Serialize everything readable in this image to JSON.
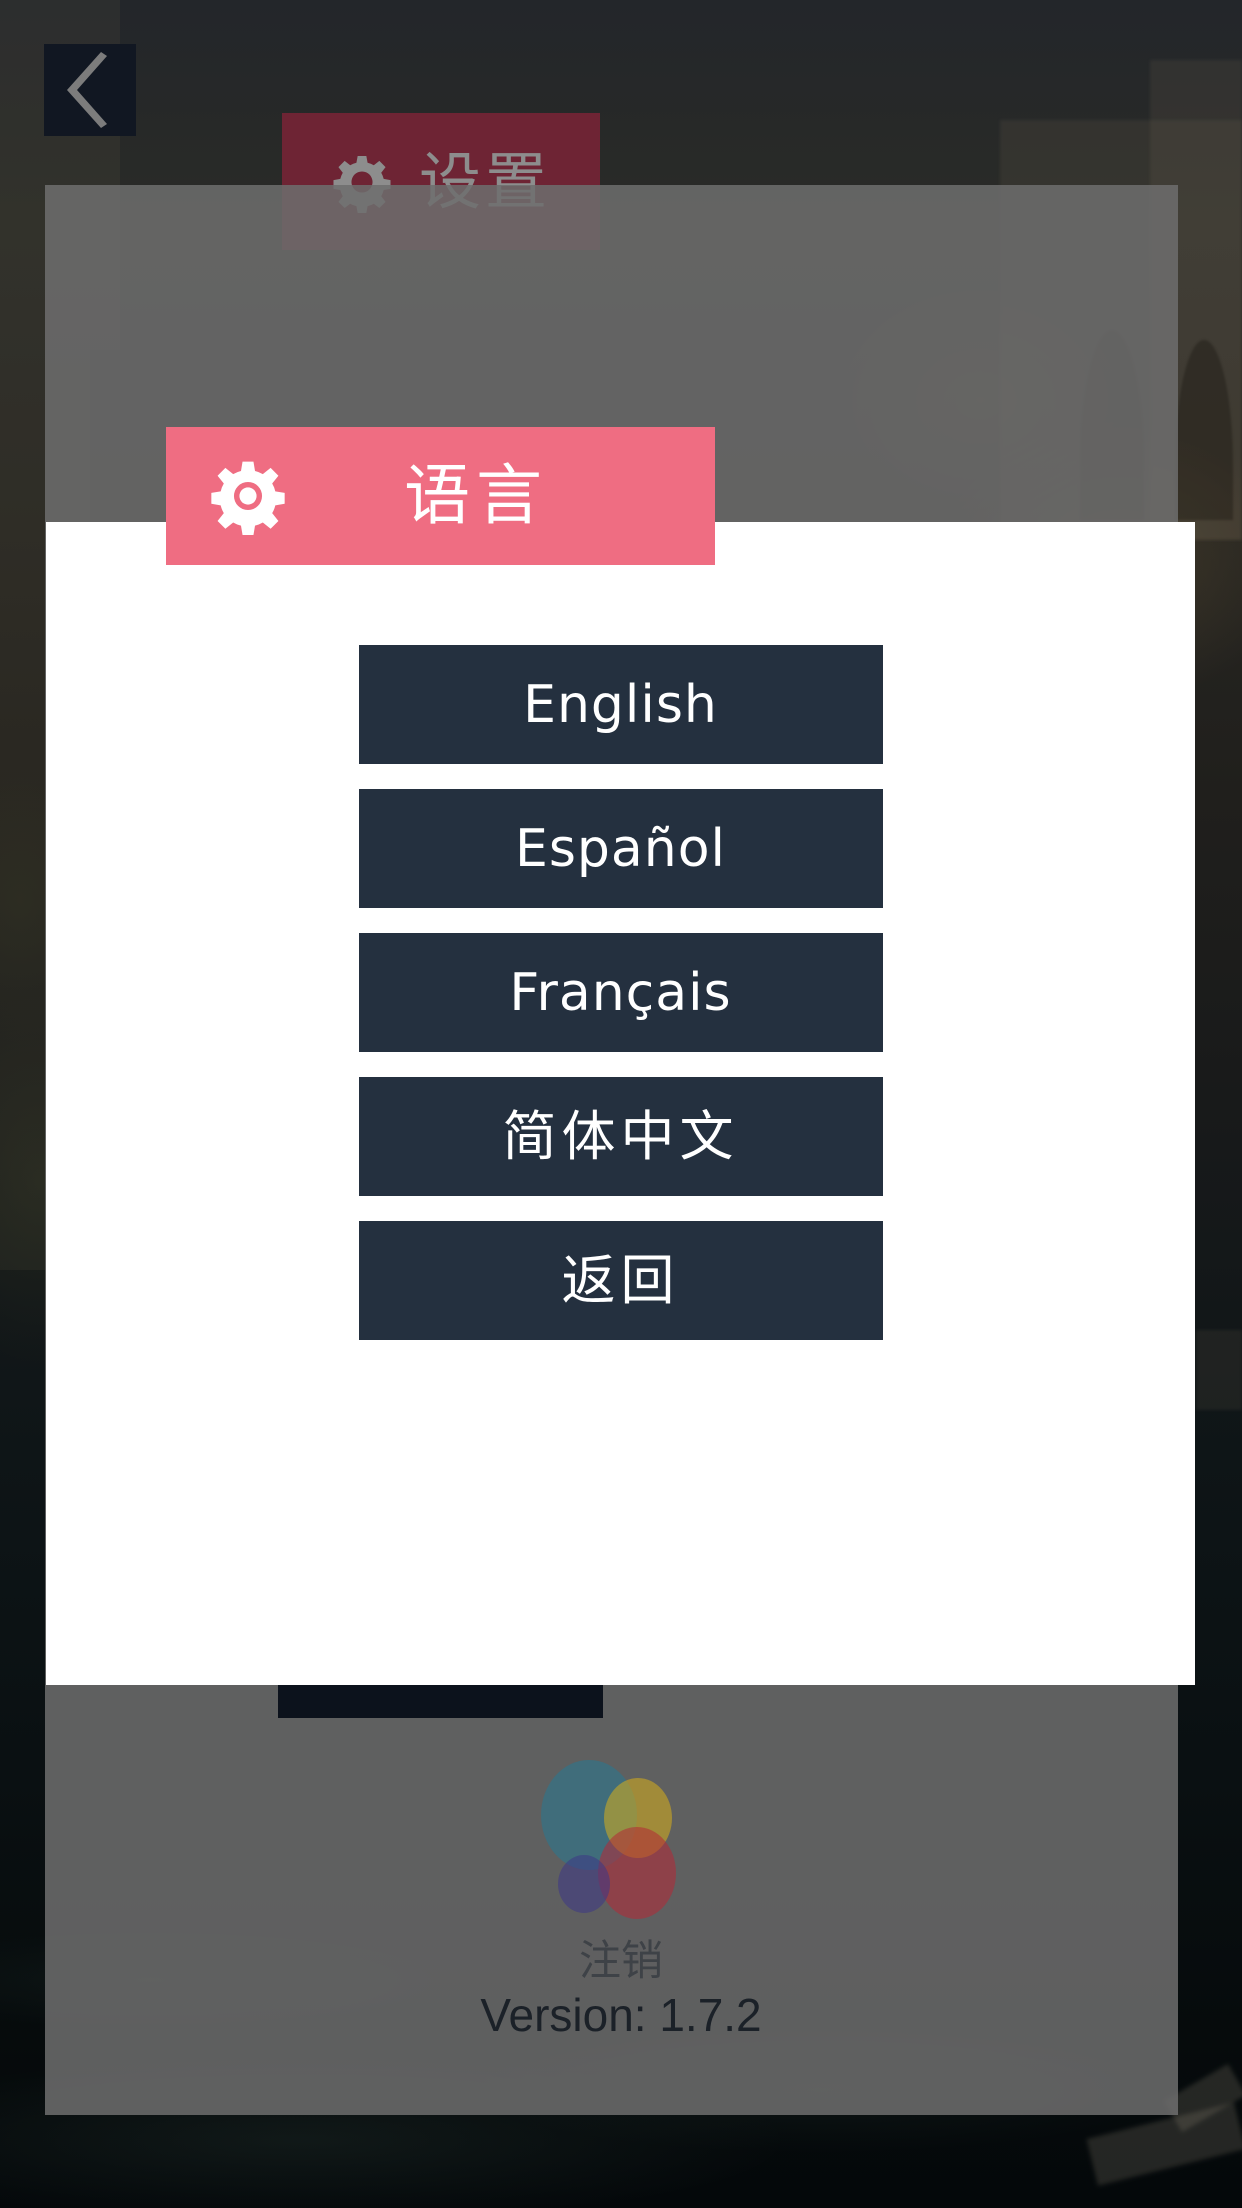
{
  "app": {
    "version_label": "Version: 1.7.2",
    "logout_label": "注销"
  },
  "nav": {
    "back_icon": "chevron-left-icon",
    "back_label": ""
  },
  "settings_page": {
    "title": "设置",
    "icon": "gear-icon"
  },
  "language_dialog": {
    "title": "语言",
    "icon": "gear-icon",
    "options": [
      {
        "label": "English",
        "cjk": false
      },
      {
        "label": "Español",
        "cjk": false
      },
      {
        "label": "Français",
        "cjk": false
      },
      {
        "label": "简体中文",
        "cjk": true
      },
      {
        "label": "返回",
        "cjk": true
      }
    ]
  },
  "colors": {
    "accent_pink": "#ef6d82",
    "settings_maroon": "#6e2434",
    "button_navy": "#24303f",
    "back_navy": "#111722",
    "scrim_gray": "#6e6e6e",
    "modal_white": "#ffffff"
  }
}
